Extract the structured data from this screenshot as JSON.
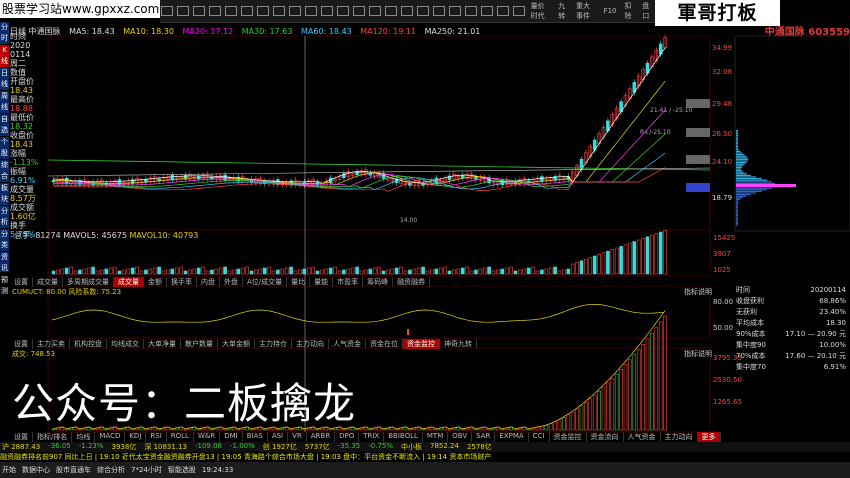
{
  "watermark_top": "股票学习站www.gpxxz.com",
  "brand_watermark": "軍哥打板",
  "overlay_text": "公众号：二板擒龙",
  "stock": {
    "title": "中通国脉 603559",
    "code_short": "日线 中通国脉"
  },
  "colors": {
    "up": "#ff4040",
    "down": "#33cc33",
    "accent": "#e6d400",
    "bg": "#000000"
  },
  "toolbar": {
    "items": [
      "",
      "",
      "",
      "",
      "",
      "",
      "",
      "",
      "",
      "",
      "",
      "",
      "",
      "",
      "",
      "",
      "",
      "",
      "",
      "",
      "",
      "",
      ""
    ],
    "right_labels": [
      "量价时代",
      "九转",
      "重大事件",
      "F10",
      "扣除",
      "盘口"
    ]
  },
  "legend": {
    "ma5": "MA5: 18.43",
    "ma10": "MA10: 18.30",
    "ma20": "MA20: 17.12",
    "ma30": "MA30: 17.63",
    "ma60": "MA60: 18.43",
    "ma120": "MA120: 19.11",
    "ma250": "MA250: 21.01"
  },
  "left_nav": [
    "分时",
    "K线",
    "日线",
    "周线",
    "自选",
    "个股",
    "综合",
    "板块",
    "分析",
    "分类",
    "资讯",
    "预测"
  ],
  "info_col": [
    {
      "t": "时间",
      "c": "w"
    },
    {
      "t": "2020",
      "c": "w"
    },
    {
      "t": "0114",
      "c": "w"
    },
    {
      "t": "周二",
      "c": "w"
    },
    {
      "t": "数值",
      "c": "w"
    },
    {
      "t": "开盘价",
      "c": "w"
    },
    {
      "t": "18.43",
      "c": "y"
    },
    {
      "t": "最高价",
      "c": "w"
    },
    {
      "t": "18.88",
      "c": "r"
    },
    {
      "t": "最低价",
      "c": "w"
    },
    {
      "t": "18.32",
      "c": "g"
    },
    {
      "t": "收盘价",
      "c": "w"
    },
    {
      "t": "18.43",
      "c": "y"
    },
    {
      "t": "涨幅",
      "c": "w"
    },
    {
      "t": "-1.13%",
      "c": "g"
    },
    {
      "t": "振幅",
      "c": "w"
    },
    {
      "t": "6.91%",
      "c": "c"
    },
    {
      "t": "成交量",
      "c": "w"
    },
    {
      "t": "8.57万",
      "c": "y"
    },
    {
      "t": "成交额",
      "c": "w"
    },
    {
      "t": "1.60亿",
      "c": "y"
    },
    {
      "t": "换手",
      "c": "w"
    },
    {
      "t": "5.75%",
      "c": "c"
    }
  ],
  "price_labels": [
    "34.99",
    "32.08",
    "29.48",
    "26.50",
    "24.10",
    "18.79"
  ],
  "annotations": [
    "21.41 / -25.10",
    "R↓/-25.10",
    "14.00"
  ],
  "volume_legend": {
    "vol": "总手: 81274",
    "ma5": "MAVOL5: 45675",
    "ma10": "MAVOL10: 40793"
  },
  "vol_axis": [
    "15425",
    "3907",
    "1025"
  ],
  "tabs_row1": [
    "设置",
    "成交量",
    "多周期成交量",
    "成交量",
    "金额",
    "换手率",
    "内盘",
    "外盘",
    "A位/成交量",
    "量比",
    "量能",
    "市盈率",
    "筹码峰",
    "融资融券"
  ],
  "tabs_row1_active": 3,
  "ind1_legend": "CUMUCT: 80.00 风险系数: 75.23",
  "ind1_axis": [
    "指标说明",
    "80.00",
    "50.00"
  ],
  "tabs_row2": [
    "设置",
    "主力买卖",
    "机构控盘",
    "均线成交",
    "大单净量",
    "散户数量",
    "大单金额",
    "主力持仓",
    "主力动向",
    "人气资金",
    "资金在位",
    "资金监控",
    "神奇九转"
  ],
  "tabs_row2_active": 11,
  "ind2_legend": "成交: 748.53",
  "ind2_axis": [
    "指标说明",
    "3795.35",
    "2530.50",
    "1265.65"
  ],
  "tabs_row3": [
    "设置",
    "指标/排名",
    "均线",
    "MACD",
    "KDJ",
    "RSI",
    "ROLL",
    "W&R",
    "DMI",
    "BIAS",
    "ASI",
    "VR",
    "ARBR",
    "DPO",
    "TRIX",
    "BBIBOLL",
    "MTM",
    "OBV",
    "SAR",
    "EXPMA",
    "CCI",
    "资金监控",
    "资金流向",
    "人气资金",
    "主力动向",
    "更多"
  ],
  "tabs_row3_active": 25,
  "right_panel": [
    {
      "k": "时间",
      "v": "20200114"
    },
    {
      "k": "收盘获利",
      "v": "68.86%"
    },
    {
      "k": "无获利",
      "v": "23.40%"
    },
    {
      "k": "平均成本",
      "v": "18.30"
    },
    {
      "k": "90%成本",
      "v": "17.10 — 20.90 元"
    },
    {
      "k": "集中度90",
      "v": "10.00%"
    },
    {
      "k": "70%成本",
      "v": "17.60 — 20.10 元"
    },
    {
      "k": "集中度70",
      "v": "6.91%"
    }
  ],
  "status": [
    "沪 2887.43",
    "-36.05",
    "-1.23%",
    "3938亿",
    "深 10831.13",
    "-109.08",
    "-1.00%",
    "创 1927亿",
    "5737亿",
    "-35.35",
    "-0.75%",
    "中小板",
    "7852.24",
    "2578亿"
  ],
  "ticker": "融资融券排名前907 同比上日 | 19:10 近代太宝资金融资融券开盘13 | 19:05 青海路个综合市场大盘 | 19:03 盘中：平台资金不断流入 | 19:14 资本市场财产",
  "bottom": [
    "开始",
    "数据中心",
    "股市直通车",
    "综合分析",
    "7*24小时",
    "智能选股",
    "19:24:33"
  ]
}
